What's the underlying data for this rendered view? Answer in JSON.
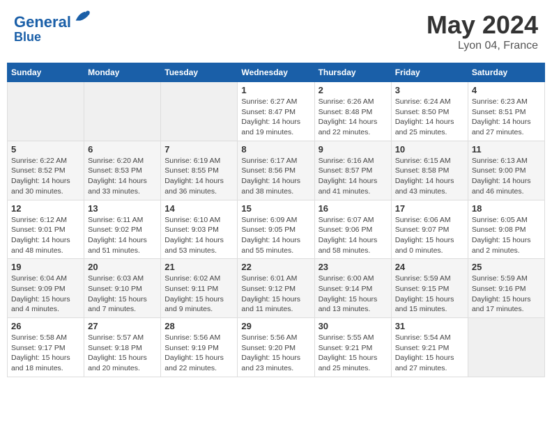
{
  "header": {
    "logo_line1": "General",
    "logo_line2": "Blue",
    "month": "May 2024",
    "location": "Lyon 04, France"
  },
  "weekdays": [
    "Sunday",
    "Monday",
    "Tuesday",
    "Wednesday",
    "Thursday",
    "Friday",
    "Saturday"
  ],
  "weeks": [
    [
      {
        "day": "",
        "info": ""
      },
      {
        "day": "",
        "info": ""
      },
      {
        "day": "",
        "info": ""
      },
      {
        "day": "1",
        "info": "Sunrise: 6:27 AM\nSunset: 8:47 PM\nDaylight: 14 hours\nand 19 minutes."
      },
      {
        "day": "2",
        "info": "Sunrise: 6:26 AM\nSunset: 8:48 PM\nDaylight: 14 hours\nand 22 minutes."
      },
      {
        "day": "3",
        "info": "Sunrise: 6:24 AM\nSunset: 8:50 PM\nDaylight: 14 hours\nand 25 minutes."
      },
      {
        "day": "4",
        "info": "Sunrise: 6:23 AM\nSunset: 8:51 PM\nDaylight: 14 hours\nand 27 minutes."
      }
    ],
    [
      {
        "day": "5",
        "info": "Sunrise: 6:22 AM\nSunset: 8:52 PM\nDaylight: 14 hours\nand 30 minutes."
      },
      {
        "day": "6",
        "info": "Sunrise: 6:20 AM\nSunset: 8:53 PM\nDaylight: 14 hours\nand 33 minutes."
      },
      {
        "day": "7",
        "info": "Sunrise: 6:19 AM\nSunset: 8:55 PM\nDaylight: 14 hours\nand 36 minutes."
      },
      {
        "day": "8",
        "info": "Sunrise: 6:17 AM\nSunset: 8:56 PM\nDaylight: 14 hours\nand 38 minutes."
      },
      {
        "day": "9",
        "info": "Sunrise: 6:16 AM\nSunset: 8:57 PM\nDaylight: 14 hours\nand 41 minutes."
      },
      {
        "day": "10",
        "info": "Sunrise: 6:15 AM\nSunset: 8:58 PM\nDaylight: 14 hours\nand 43 minutes."
      },
      {
        "day": "11",
        "info": "Sunrise: 6:13 AM\nSunset: 9:00 PM\nDaylight: 14 hours\nand 46 minutes."
      }
    ],
    [
      {
        "day": "12",
        "info": "Sunrise: 6:12 AM\nSunset: 9:01 PM\nDaylight: 14 hours\nand 48 minutes."
      },
      {
        "day": "13",
        "info": "Sunrise: 6:11 AM\nSunset: 9:02 PM\nDaylight: 14 hours\nand 51 minutes."
      },
      {
        "day": "14",
        "info": "Sunrise: 6:10 AM\nSunset: 9:03 PM\nDaylight: 14 hours\nand 53 minutes."
      },
      {
        "day": "15",
        "info": "Sunrise: 6:09 AM\nSunset: 9:05 PM\nDaylight: 14 hours\nand 55 minutes."
      },
      {
        "day": "16",
        "info": "Sunrise: 6:07 AM\nSunset: 9:06 PM\nDaylight: 14 hours\nand 58 minutes."
      },
      {
        "day": "17",
        "info": "Sunrise: 6:06 AM\nSunset: 9:07 PM\nDaylight: 15 hours\nand 0 minutes."
      },
      {
        "day": "18",
        "info": "Sunrise: 6:05 AM\nSunset: 9:08 PM\nDaylight: 15 hours\nand 2 minutes."
      }
    ],
    [
      {
        "day": "19",
        "info": "Sunrise: 6:04 AM\nSunset: 9:09 PM\nDaylight: 15 hours\nand 4 minutes."
      },
      {
        "day": "20",
        "info": "Sunrise: 6:03 AM\nSunset: 9:10 PM\nDaylight: 15 hours\nand 7 minutes."
      },
      {
        "day": "21",
        "info": "Sunrise: 6:02 AM\nSunset: 9:11 PM\nDaylight: 15 hours\nand 9 minutes."
      },
      {
        "day": "22",
        "info": "Sunrise: 6:01 AM\nSunset: 9:12 PM\nDaylight: 15 hours\nand 11 minutes."
      },
      {
        "day": "23",
        "info": "Sunrise: 6:00 AM\nSunset: 9:14 PM\nDaylight: 15 hours\nand 13 minutes."
      },
      {
        "day": "24",
        "info": "Sunrise: 5:59 AM\nSunset: 9:15 PM\nDaylight: 15 hours\nand 15 minutes."
      },
      {
        "day": "25",
        "info": "Sunrise: 5:59 AM\nSunset: 9:16 PM\nDaylight: 15 hours\nand 17 minutes."
      }
    ],
    [
      {
        "day": "26",
        "info": "Sunrise: 5:58 AM\nSunset: 9:17 PM\nDaylight: 15 hours\nand 18 minutes."
      },
      {
        "day": "27",
        "info": "Sunrise: 5:57 AM\nSunset: 9:18 PM\nDaylight: 15 hours\nand 20 minutes."
      },
      {
        "day": "28",
        "info": "Sunrise: 5:56 AM\nSunset: 9:19 PM\nDaylight: 15 hours\nand 22 minutes."
      },
      {
        "day": "29",
        "info": "Sunrise: 5:56 AM\nSunset: 9:20 PM\nDaylight: 15 hours\nand 23 minutes."
      },
      {
        "day": "30",
        "info": "Sunrise: 5:55 AM\nSunset: 9:21 PM\nDaylight: 15 hours\nand 25 minutes."
      },
      {
        "day": "31",
        "info": "Sunrise: 5:54 AM\nSunset: 9:21 PM\nDaylight: 15 hours\nand 27 minutes."
      },
      {
        "day": "",
        "info": ""
      }
    ]
  ]
}
